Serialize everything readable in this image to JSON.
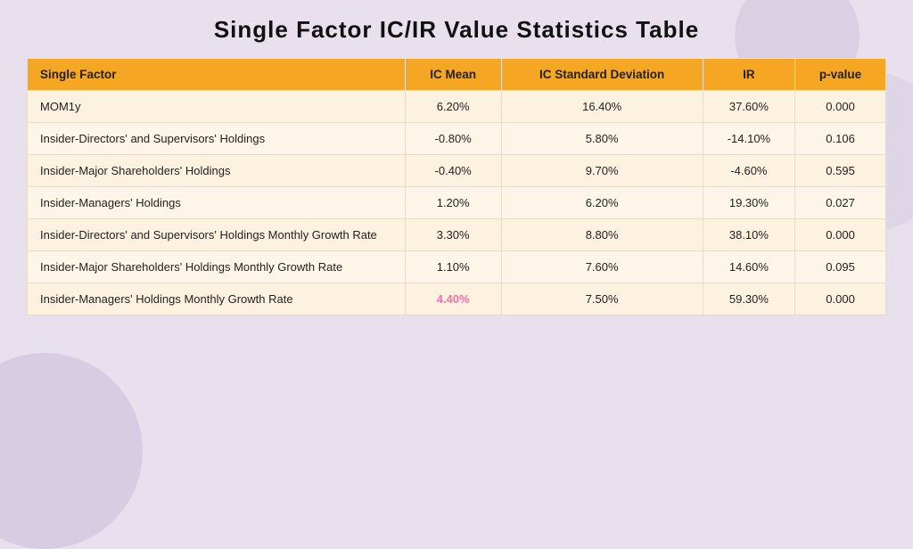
{
  "title": "Single Factor IC/IR  Value Statistics Table",
  "table": {
    "headers": [
      {
        "key": "factor",
        "label": "Single Factor",
        "align": "left"
      },
      {
        "key": "ic_mean",
        "label": "IC   Mean",
        "align": "center"
      },
      {
        "key": "ic_std",
        "label": "IC Standard Deviation",
        "align": "center"
      },
      {
        "key": "ir",
        "label": "IR",
        "align": "center"
      },
      {
        "key": "pvalue",
        "label": "p-value",
        "align": "center"
      }
    ],
    "rows": [
      {
        "factor": "MOM1y",
        "ic_mean": "6.20%",
        "ic_mean_highlight": false,
        "ic_std": "16.40%",
        "ir": "37.60%",
        "pvalue": "0.000"
      },
      {
        "factor": "Insider-Directors'  and  Supervisors'  Holdings",
        "ic_mean": "-0.80%",
        "ic_mean_highlight": false,
        "ic_std": "5.80%",
        "ir": "-14.10%",
        "pvalue": "0.106"
      },
      {
        "factor": "Insider-Major  Shareholders'  Holdings",
        "ic_mean": "-0.40%",
        "ic_mean_highlight": false,
        "ic_std": "9.70%",
        "ir": "-4.60%",
        "pvalue": "0.595"
      },
      {
        "factor": "Insider-Managers'  Holdings",
        "ic_mean": "1.20%",
        "ic_mean_highlight": false,
        "ic_std": "6.20%",
        "ir": "19.30%",
        "pvalue": "0.027"
      },
      {
        "factor": "Insider-Directors'  and  Supervisors'  Holdings  Monthly Growth Rate",
        "ic_mean": "3.30%",
        "ic_mean_highlight": false,
        "ic_std": "8.80%",
        "ir": "38.10%",
        "pvalue": "0.000"
      },
      {
        "factor": "Insider-Major  Shareholders'  Holdings  Monthly  Growth  Rate",
        "ic_mean": "1.10%",
        "ic_mean_highlight": false,
        "ic_std": "7.60%",
        "ir": "14.60%",
        "pvalue": "0.095"
      },
      {
        "factor": "Insider-Managers'  Holdings  Monthly  Growth  Rate",
        "ic_mean": "4.40%",
        "ic_mean_highlight": true,
        "ic_std": "7.50%",
        "ir": "59.30%",
        "pvalue": "0.000"
      }
    ]
  }
}
